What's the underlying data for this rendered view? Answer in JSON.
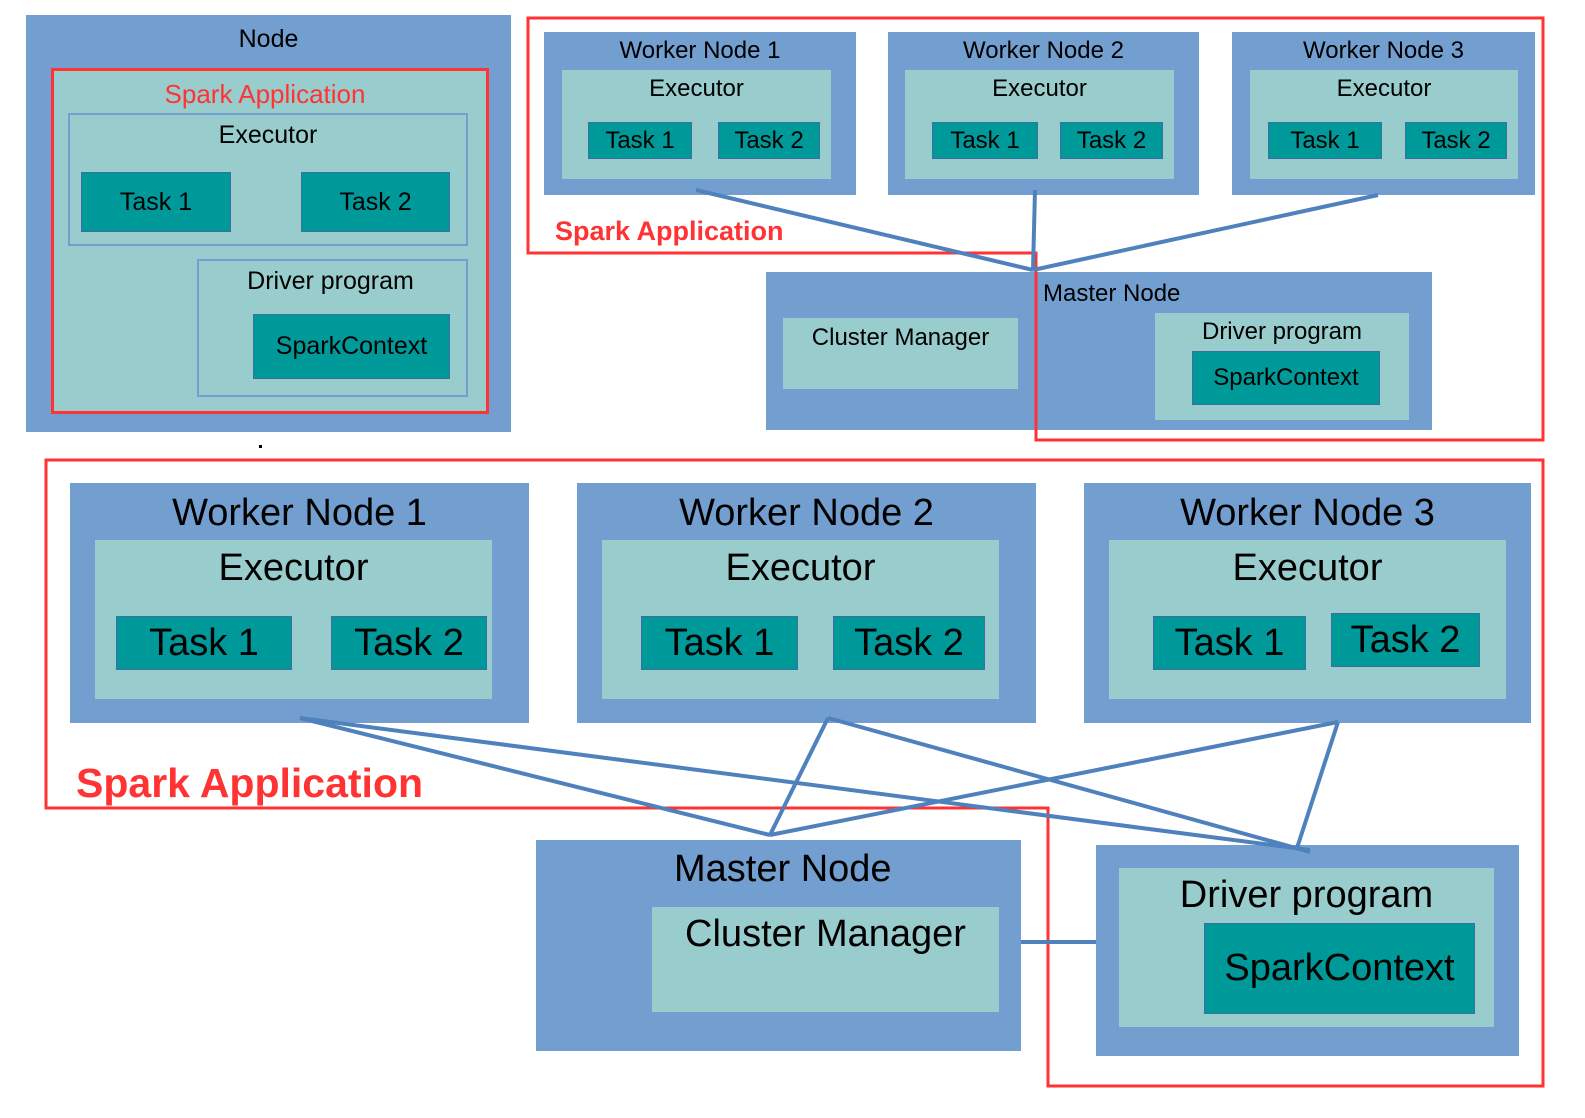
{
  "colors": {
    "node": "#729fcf",
    "container": "#99cccc",
    "task": "#009999",
    "application_outline": "#ff3333",
    "connector": "#4f81bd"
  },
  "panel1": {
    "node": "Node",
    "app": "Spark Application",
    "executor": "Executor",
    "task1": "Task 1",
    "task2": "Task 2",
    "driver": "Driver program",
    "context": "SparkContext"
  },
  "panel2": {
    "workers": [
      {
        "name": "Worker Node 1",
        "executor": "Executor",
        "tasks": [
          "Task 1",
          "Task 2"
        ]
      },
      {
        "name": "Worker Node 2",
        "executor": "Executor",
        "tasks": [
          "Task 1",
          "Task 2"
        ]
      },
      {
        "name": "Worker Node 3",
        "executor": "Executor",
        "tasks": [
          "Task 1",
          "Task 2"
        ]
      }
    ],
    "app": "Spark Application",
    "master": "Master Node",
    "cluster_manager": "Cluster Manager",
    "driver": "Driver program",
    "context": "SparkContext"
  },
  "panel3": {
    "workers": [
      {
        "name": "Worker Node 1",
        "executor": "Executor",
        "tasks": [
          "Task 1",
          "Task 2"
        ]
      },
      {
        "name": "Worker Node 2",
        "executor": "Executor",
        "tasks": [
          "Task 1",
          "Task 2"
        ]
      },
      {
        "name": "Worker Node 3",
        "executor": "Executor",
        "tasks": [
          "Task 1",
          "Task 2"
        ]
      }
    ],
    "app": "Spark Application",
    "master": "Master Node",
    "cluster_manager": "Cluster Manager",
    "driver": "Driver program",
    "context": "SparkContext"
  }
}
